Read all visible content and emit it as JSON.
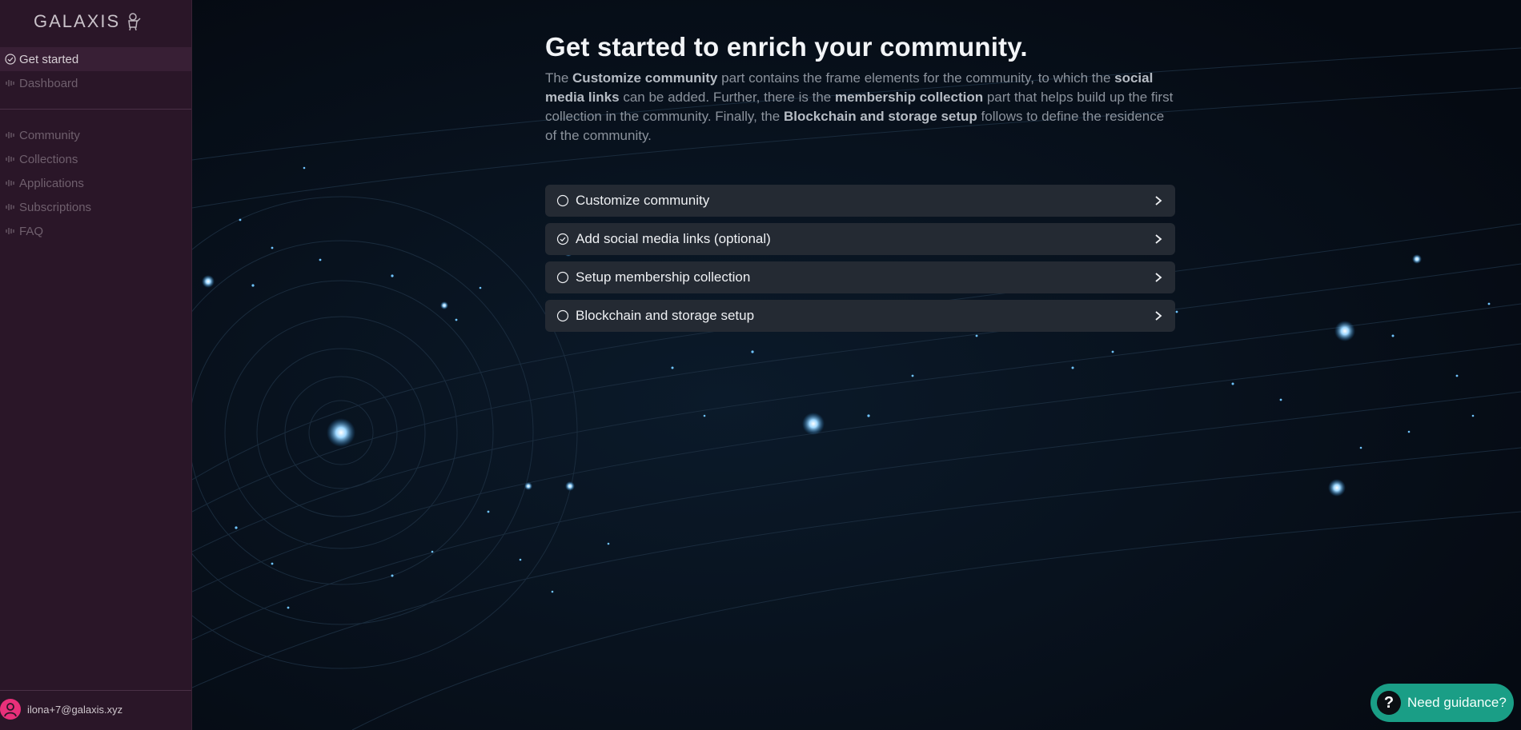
{
  "brand": {
    "name": "GALAXIS"
  },
  "sidebar": {
    "primary": [
      {
        "label": "Get started",
        "icon": "check-circle-icon",
        "active": true
      },
      {
        "label": "Dashboard",
        "icon": "waveform-icon"
      }
    ],
    "secondary": [
      {
        "label": "Community",
        "icon": "waveform-icon"
      },
      {
        "label": "Collections",
        "icon": "waveform-icon"
      },
      {
        "label": "Applications",
        "icon": "waveform-icon"
      },
      {
        "label": "Subscriptions",
        "icon": "waveform-icon"
      },
      {
        "label": "FAQ",
        "icon": "waveform-icon"
      }
    ],
    "user_email": "ilona+7@galaxis.xyz"
  },
  "main": {
    "title": "Get started to enrich your community.",
    "desc": {
      "t1": "The ",
      "b1": "Customize community",
      "t2": " part contains the frame elements for the community, to which the ",
      "b2": "social media links",
      "t3": " can be added. Further, there is the ",
      "b3": "membership collection",
      "t4": " part that helps build up the first collection in the community. Finally, the ",
      "b4": "Blockchain and storage setup",
      "t5": " follows to define the residence of the community."
    },
    "steps": [
      {
        "label": "Customize community",
        "done": false
      },
      {
        "label": "Add social media links (optional)",
        "done": true
      },
      {
        "label": "Setup membership collection",
        "done": false
      },
      {
        "label": "Blockchain and storage setup",
        "done": false
      }
    ]
  },
  "help": {
    "label": "Need guidance?",
    "icon": "question-icon"
  },
  "colors": {
    "sidebar_bg": "#2a1628",
    "main_bg": "#060d16",
    "step_bg": "#242a33",
    "help_bg": "#1a9e86",
    "avatar": "#e8307a"
  }
}
